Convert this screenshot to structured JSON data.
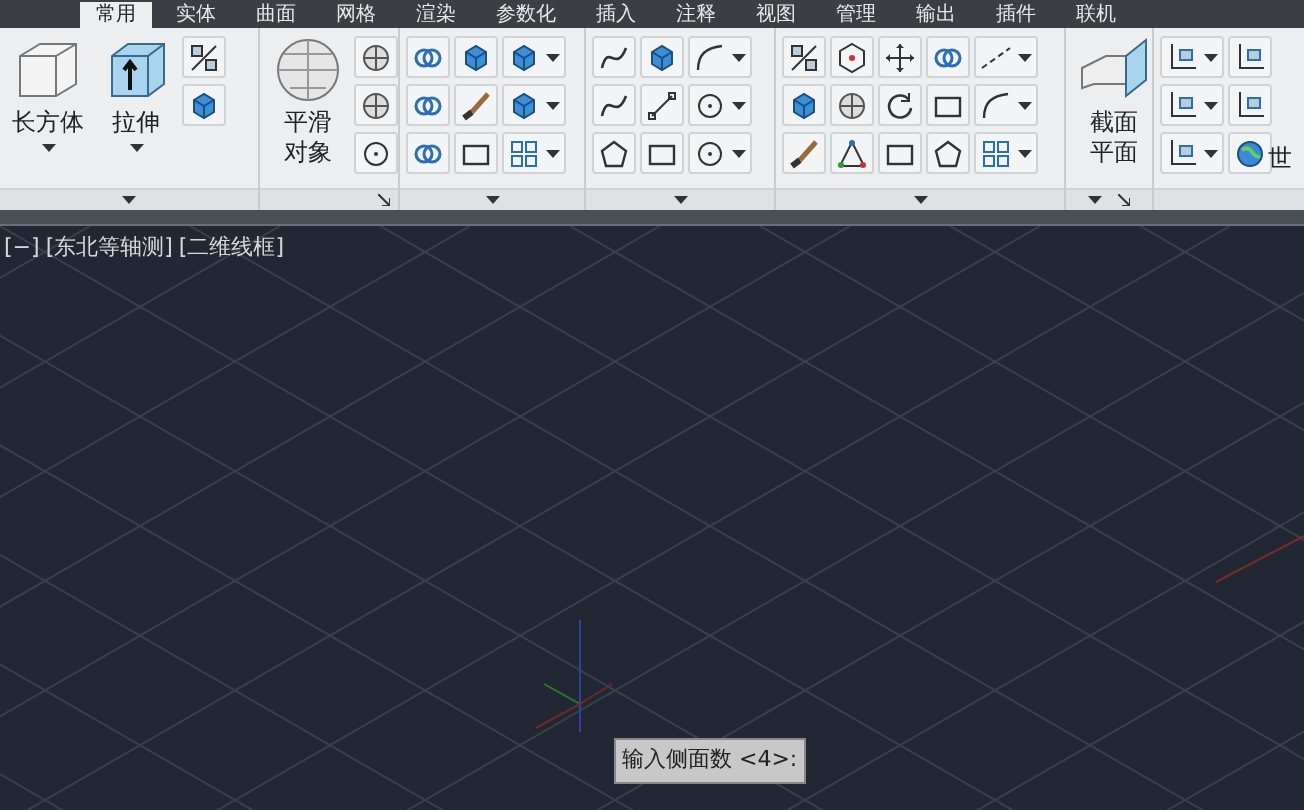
{
  "tabs": [
    {
      "label": "常用",
      "selected": true
    },
    {
      "label": "实体",
      "selected": false
    },
    {
      "label": "曲面",
      "selected": false
    },
    {
      "label": "网格",
      "selected": false
    },
    {
      "label": "渲染",
      "selected": false
    },
    {
      "label": "参数化",
      "selected": false
    },
    {
      "label": "插入",
      "selected": false
    },
    {
      "label": "注释",
      "selected": false
    },
    {
      "label": "视图",
      "selected": false
    },
    {
      "label": "管理",
      "selected": false
    },
    {
      "label": "输出",
      "selected": false
    },
    {
      "label": "插件",
      "selected": false
    },
    {
      "label": "联机",
      "selected": false
    }
  ],
  "ribbon": {
    "big_buttons": [
      {
        "label": "长方体"
      },
      {
        "label": "拉伸"
      },
      {
        "label": "平滑对象"
      },
      {
        "label": "截面平面"
      }
    ],
    "world_label": "世"
  },
  "viewport": {
    "labels": [
      "[−]",
      "[东北等轴测]",
      "[二维线框]"
    ],
    "prompt": "输入侧面数 <4>:"
  }
}
